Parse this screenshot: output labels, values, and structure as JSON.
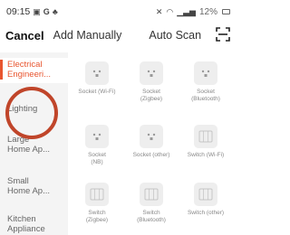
{
  "status": {
    "time": "09:15",
    "battery": "12%"
  },
  "nav": {
    "cancel": "Cancel",
    "tab_manual": "Add Manually",
    "tab_auto": "Auto Scan"
  },
  "sidebar": {
    "items": [
      {
        "line1": "Electrical",
        "line2": "Engineeri..."
      },
      {
        "line1": "Lighting",
        "line2": ""
      },
      {
        "line1": "Large",
        "line2": "Home Ap..."
      },
      {
        "line1": "Small",
        "line2": "Home Ap..."
      },
      {
        "line1": "Kitchen",
        "line2": "Appliance"
      }
    ]
  },
  "devices": [
    {
      "line1": "Socket (Wi-Fi)",
      "line2": "",
      "icon": "socket-icon"
    },
    {
      "line1": "Socket",
      "line2": "(Zigbee)",
      "icon": "socket-icon"
    },
    {
      "line1": "Socket",
      "line2": "(Bluetooth)",
      "icon": "socket-icon"
    },
    {
      "line1": "Socket",
      "line2": "(NB)",
      "icon": "socket-icon"
    },
    {
      "line1": "Socket (other)",
      "line2": "",
      "icon": "socket-icon"
    },
    {
      "line1": "Switch (Wi-Fi)",
      "line2": "",
      "icon": "switch-icon"
    },
    {
      "line1": "Switch",
      "line2": "(Zigbee)",
      "icon": "switch-icon"
    },
    {
      "line1": "Switch",
      "line2": "(Bluetooth)",
      "icon": "switch-icon"
    },
    {
      "line1": "Switch (other)",
      "line2": "",
      "icon": "switch-icon"
    }
  ],
  "colors": {
    "accent": "#e8552f",
    "highlight": "#c0452a",
    "sidebar_bg": "#f4f4f4"
  }
}
